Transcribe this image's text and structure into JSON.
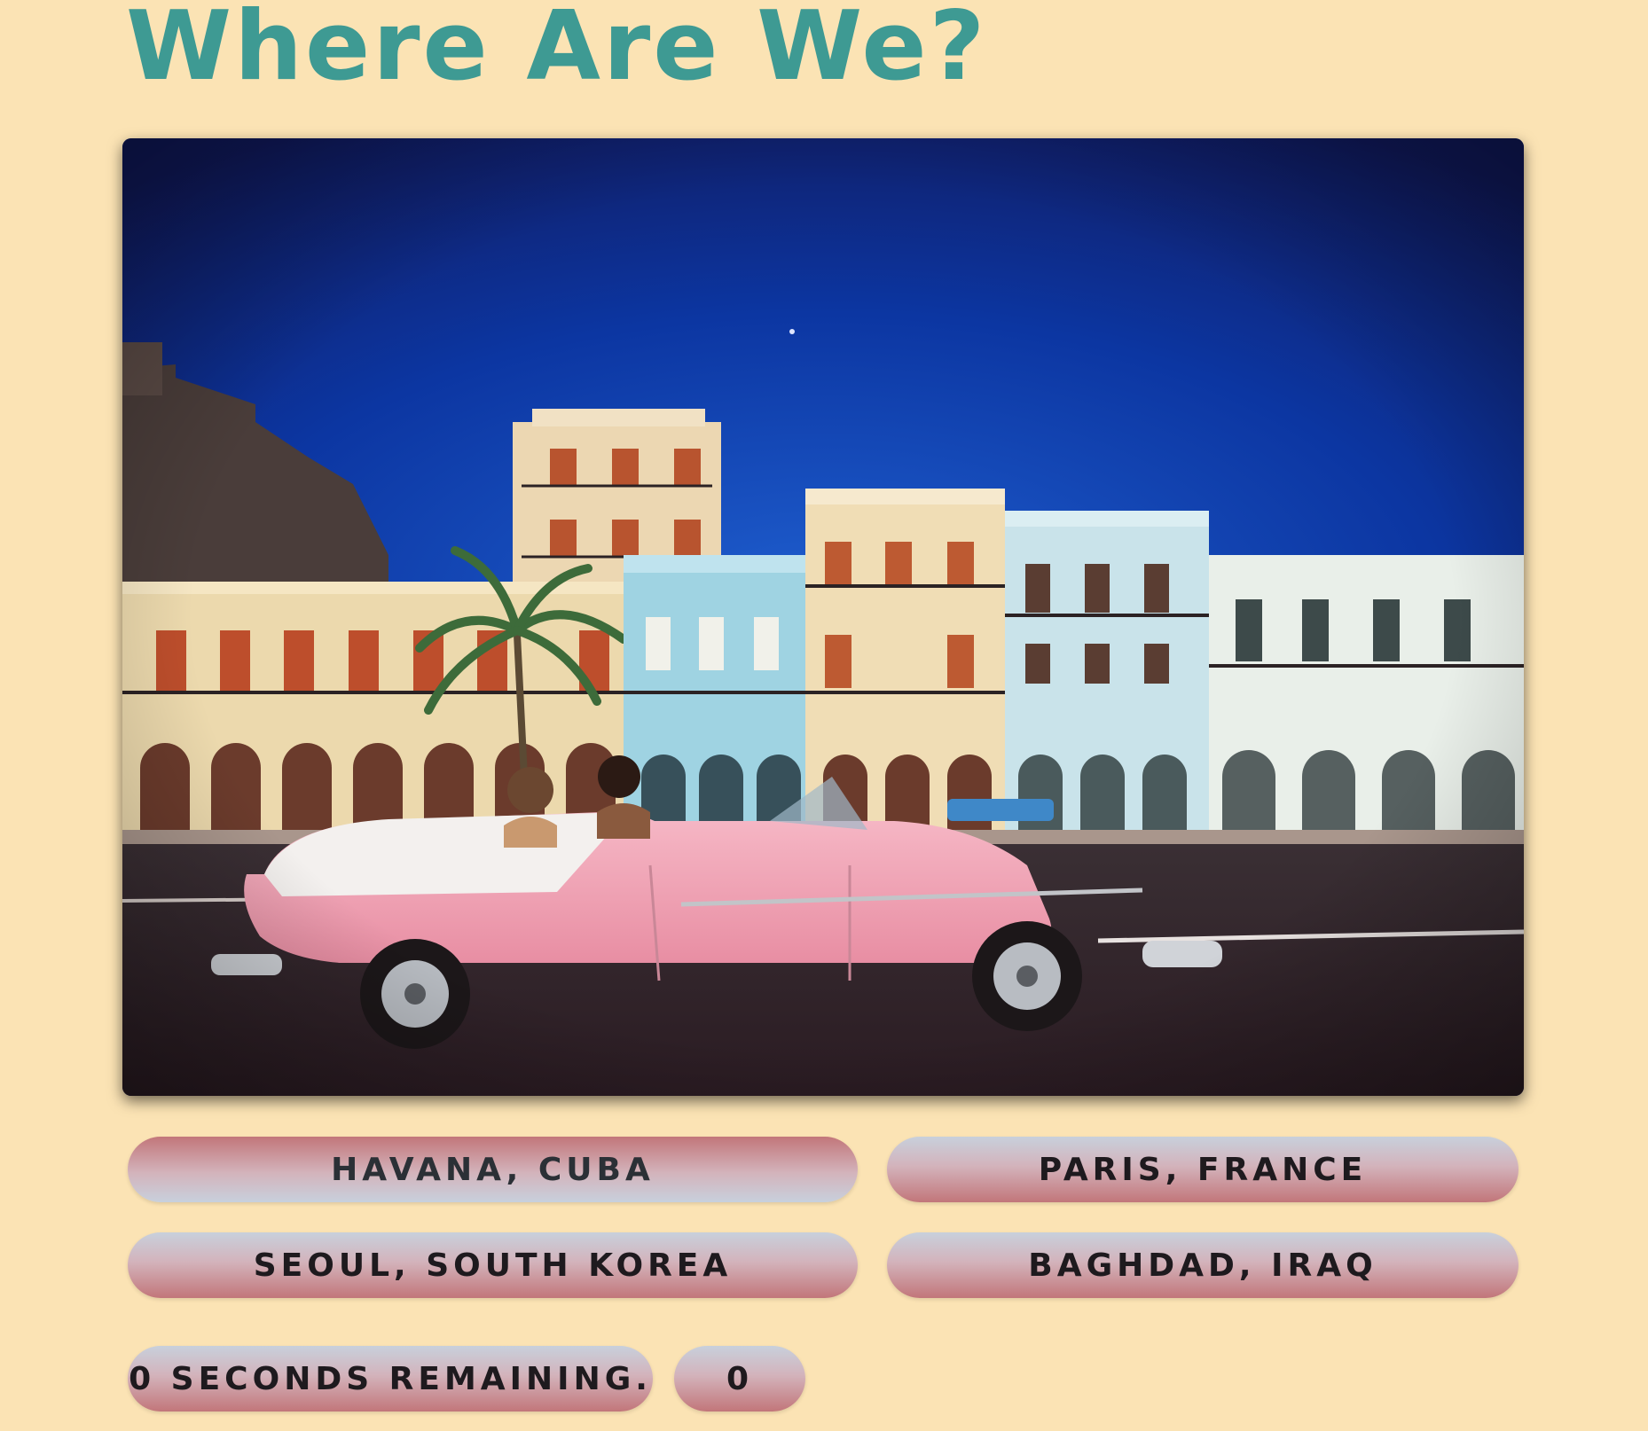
{
  "header": {
    "title": "Where Are We?"
  },
  "photo": {
    "icon": "havana-street-photo",
    "accent_sky": "#0b2b8f",
    "accent_car": "#f2a9b9"
  },
  "answers": [
    {
      "label": "Havana, Cuba"
    },
    {
      "label": "Paris, France"
    },
    {
      "label": "Seoul, South Korea"
    },
    {
      "label": "Baghdad, Iraq"
    }
  ],
  "status": {
    "timer_text": "0 seconds remaining.",
    "score": "0"
  },
  "colors": {
    "background": "#fbe3b4",
    "title": "#3e9a93",
    "button_top": "#c8d0dc",
    "button_bottom": "#c2767a"
  }
}
